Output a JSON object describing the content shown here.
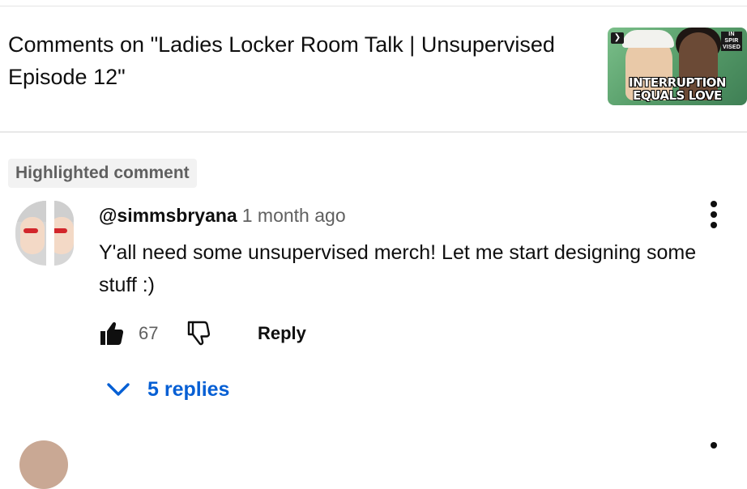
{
  "header": {
    "title": "Comments on \"Ladies Locker Room Talk | Unsupervised Episode 12\"",
    "thumbnail": {
      "caption_line1": "INTERRUPTION",
      "caption_line2": "EQUALS LOVE",
      "channel_logo": "IN SPIR VISED"
    }
  },
  "comment": {
    "highlight_label": "Highlighted comment",
    "author": "@simmsbryana",
    "time": "1 month ago",
    "text": "Y'all need some unsupervised merch! Let me start designing some stuff :)",
    "likes": "67",
    "reply_label": "Reply",
    "replies_label": "5 replies"
  },
  "icons": {
    "like": "thumbs-up-icon",
    "dislike": "thumbs-down-icon",
    "menu": "more-vert-icon",
    "expand": "chevron-down-icon",
    "play": "play-badge-icon"
  },
  "colors": {
    "link_blue": "#065fd4",
    "secondary_text": "#606060",
    "primary_text": "#0f0f0f",
    "chip_bg": "#f2f2f2"
  }
}
